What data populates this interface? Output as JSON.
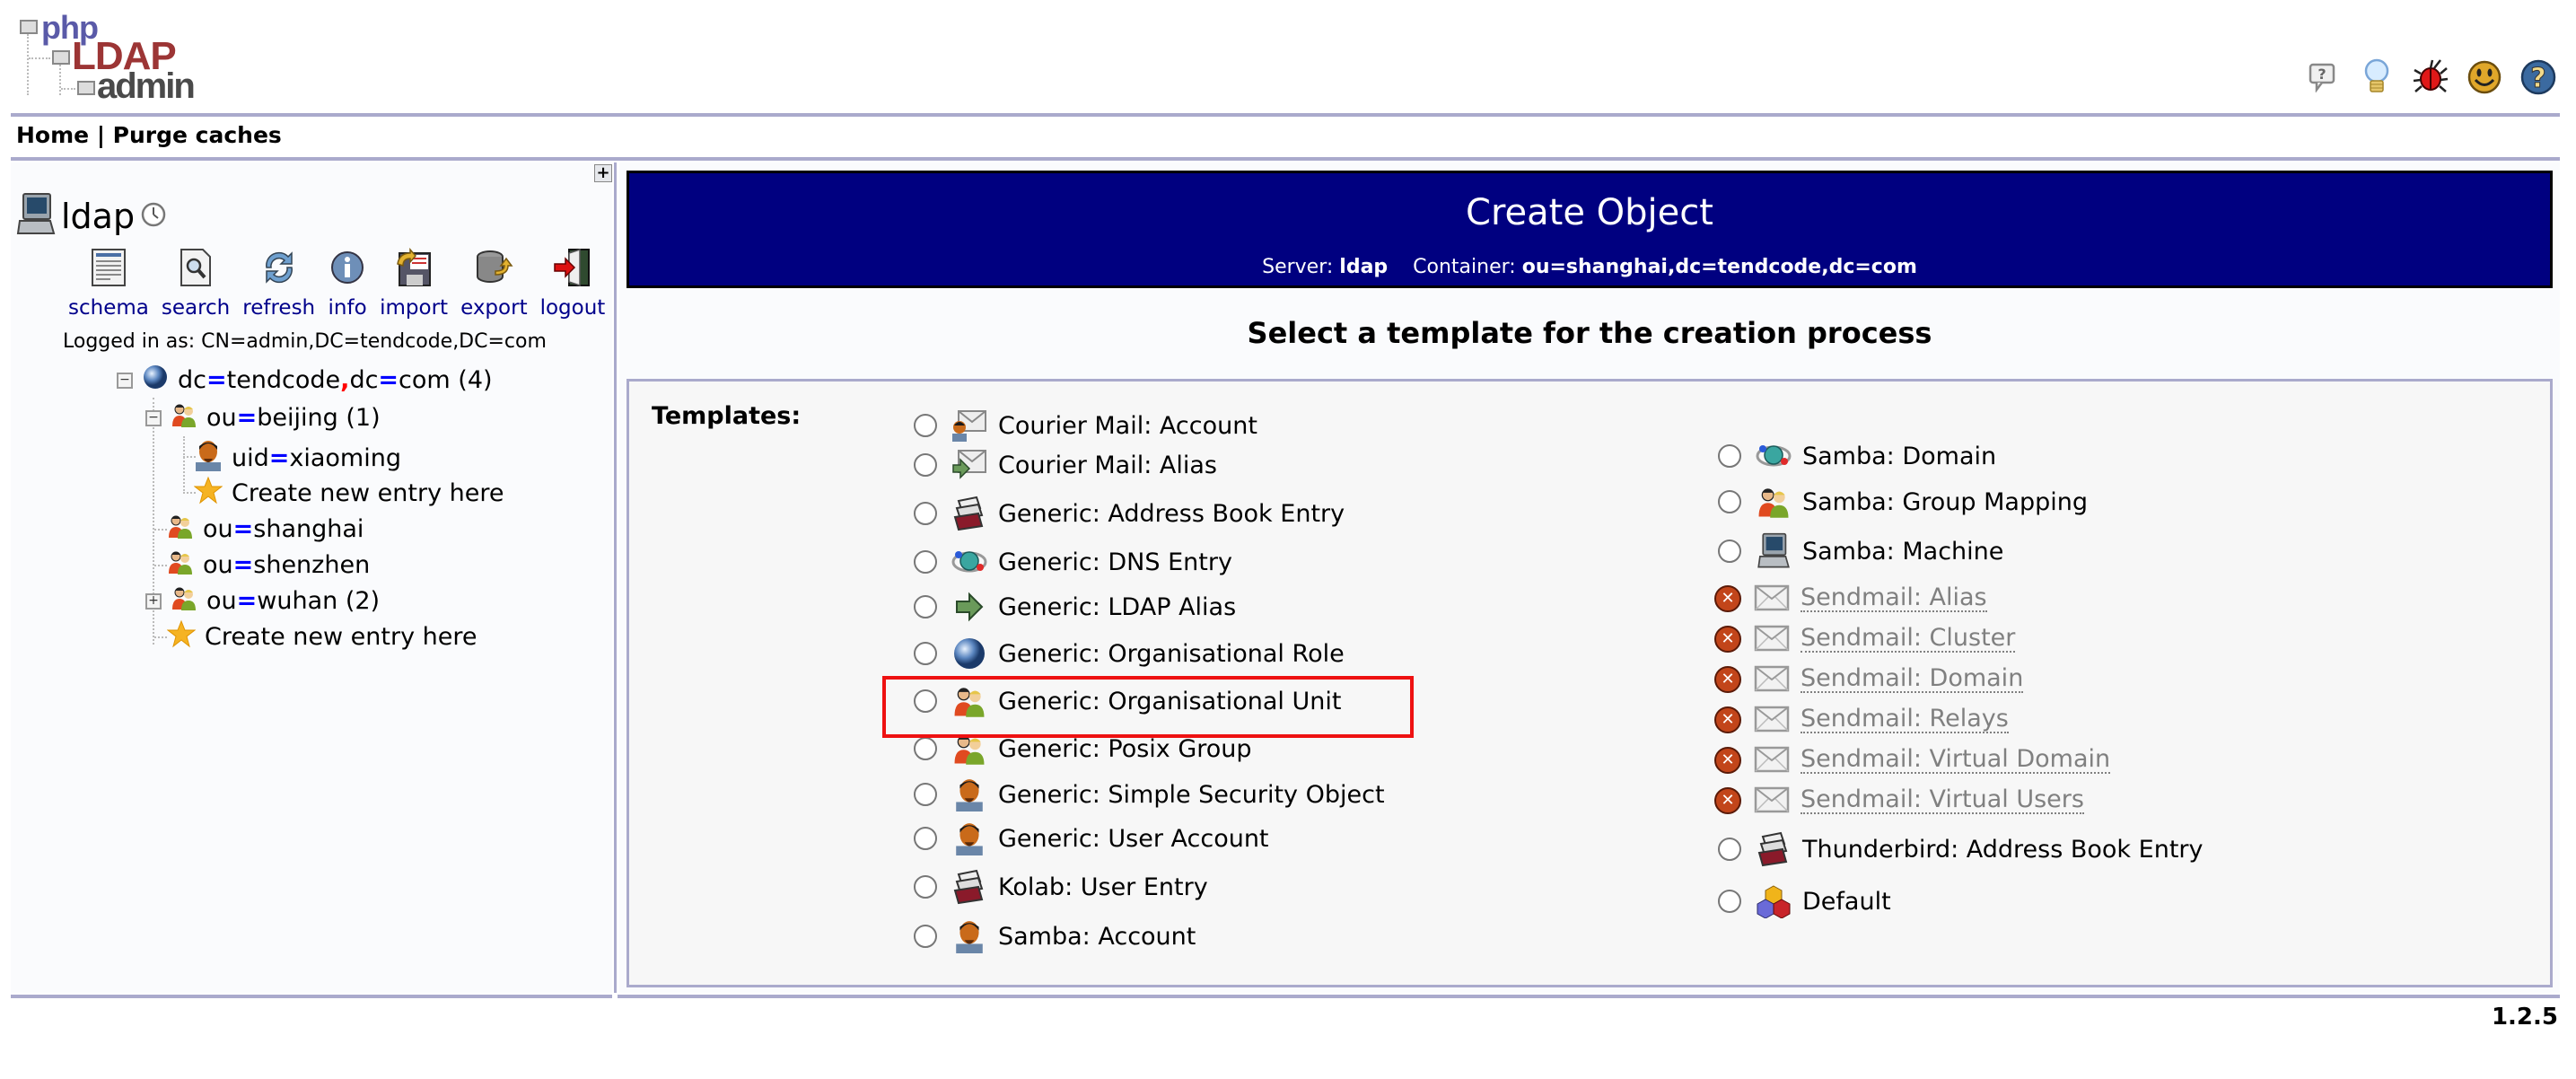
{
  "header": {
    "logo": {
      "line1": "php",
      "line2": "LDAP",
      "line3": "admin"
    },
    "top_icons": [
      {
        "name": "help-bubble-icon",
        "title": "Help"
      },
      {
        "name": "lightbulb-icon",
        "title": "Request feature"
      },
      {
        "name": "bug-icon",
        "title": "Report a bug"
      },
      {
        "name": "smiley-icon",
        "title": "Donate"
      },
      {
        "name": "help-circle-icon",
        "title": "Documentation"
      }
    ]
  },
  "nav": {
    "home": "Home",
    "separator": " | ",
    "purge": "Purge caches"
  },
  "sidebar": {
    "server_name": "ldap",
    "toolbar": [
      {
        "id": "schema",
        "label": "schema",
        "icon": "schema-icon"
      },
      {
        "id": "search",
        "label": "search",
        "icon": "search-icon"
      },
      {
        "id": "refresh",
        "label": "refresh",
        "icon": "refresh-icon"
      },
      {
        "id": "info",
        "label": "info",
        "icon": "info-icon"
      },
      {
        "id": "import",
        "label": "import",
        "icon": "import-icon"
      },
      {
        "id": "export",
        "label": "export",
        "icon": "export-icon"
      },
      {
        "id": "logout",
        "label": "logout",
        "icon": "logout-icon"
      }
    ],
    "logged_in": "Logged in as: CN=admin,DC=tendcode,DC=com",
    "tree": {
      "root": {
        "a1": "dc",
        "v1": "tendcode",
        "a2": "dc",
        "v2": "com",
        "count": " (4)"
      },
      "beijing": {
        "attr": "ou",
        "val": "beijing",
        "count": " (1)"
      },
      "xiaoming": {
        "attr": "uid",
        "val": "xiaoming"
      },
      "create_beijing": "Create new entry here",
      "shanghai": {
        "attr": "ou",
        "val": "shanghai"
      },
      "shenzhen": {
        "attr": "ou",
        "val": "shenzhen"
      },
      "wuhan": {
        "attr": "ou",
        "val": "wuhan",
        "count": " (2)"
      },
      "create_root": "Create new entry here"
    }
  },
  "main": {
    "title": "Create Object",
    "server_label": "Server:",
    "server_value": "ldap",
    "container_label": "Container:",
    "container_value": "ou=shanghai,dc=tendcode,dc=com",
    "heading": "Select a template for the creation process",
    "templates_label": "Templates:",
    "templates_left": [
      {
        "label": "Courier Mail: Account",
        "icon": "mail-user-icon",
        "enabled": true
      },
      {
        "label": "Courier Mail: Alias",
        "icon": "mail-alias-icon",
        "enabled": true
      },
      {
        "label": "Generic: Address Book Entry",
        "icon": "address-book-icon",
        "enabled": true
      },
      {
        "label": "Generic: DNS Entry",
        "icon": "dns-globe-icon",
        "enabled": true
      },
      {
        "label": "Generic: LDAP Alias",
        "icon": "arrow-right-icon",
        "enabled": true
      },
      {
        "label": "Generic: Organisational Role",
        "icon": "globe-icon",
        "enabled": true
      },
      {
        "label": "Generic: Organisational Unit",
        "icon": "group-icon",
        "enabled": true,
        "highlighted": true
      },
      {
        "label": "Generic: Posix Group",
        "icon": "group-icon",
        "enabled": true
      },
      {
        "label": "Generic: Simple Security Object",
        "icon": "user-icon",
        "enabled": true
      },
      {
        "label": "Generic: User Account",
        "icon": "user-icon",
        "enabled": true
      },
      {
        "label": "Kolab: User Entry",
        "icon": "address-book-icon",
        "enabled": true
      },
      {
        "label": "Samba: Account",
        "icon": "user-icon",
        "enabled": true
      }
    ],
    "templates_right": [
      {
        "label": "Samba: Domain",
        "icon": "dns-globe-icon",
        "enabled": true
      },
      {
        "label": "Samba: Group Mapping",
        "icon": "group-icon",
        "enabled": true
      },
      {
        "label": "Samba: Machine",
        "icon": "computer-icon",
        "enabled": true
      },
      {
        "label": "Sendmail: Alias",
        "icon": "mail-icon",
        "enabled": false
      },
      {
        "label": "Sendmail: Cluster",
        "icon": "mail-icon",
        "enabled": false
      },
      {
        "label": "Sendmail: Domain",
        "icon": "mail-icon",
        "enabled": false
      },
      {
        "label": "Sendmail: Relays",
        "icon": "mail-icon",
        "enabled": false
      },
      {
        "label": "Sendmail: Virtual Domain",
        "icon": "mail-icon",
        "enabled": false
      },
      {
        "label": "Sendmail: Virtual Users",
        "icon": "mail-icon",
        "enabled": false
      },
      {
        "label": "Thunderbird: Address Book Entry",
        "icon": "address-book-icon",
        "enabled": true
      },
      {
        "label": "Default",
        "icon": "cubes-icon",
        "enabled": true
      }
    ]
  },
  "footer": {
    "version": "1.2.5"
  },
  "colors": {
    "header_bg": "#000080",
    "rule": "#aaaacc",
    "link": "#00008b",
    "highlight": "#ee1111"
  }
}
